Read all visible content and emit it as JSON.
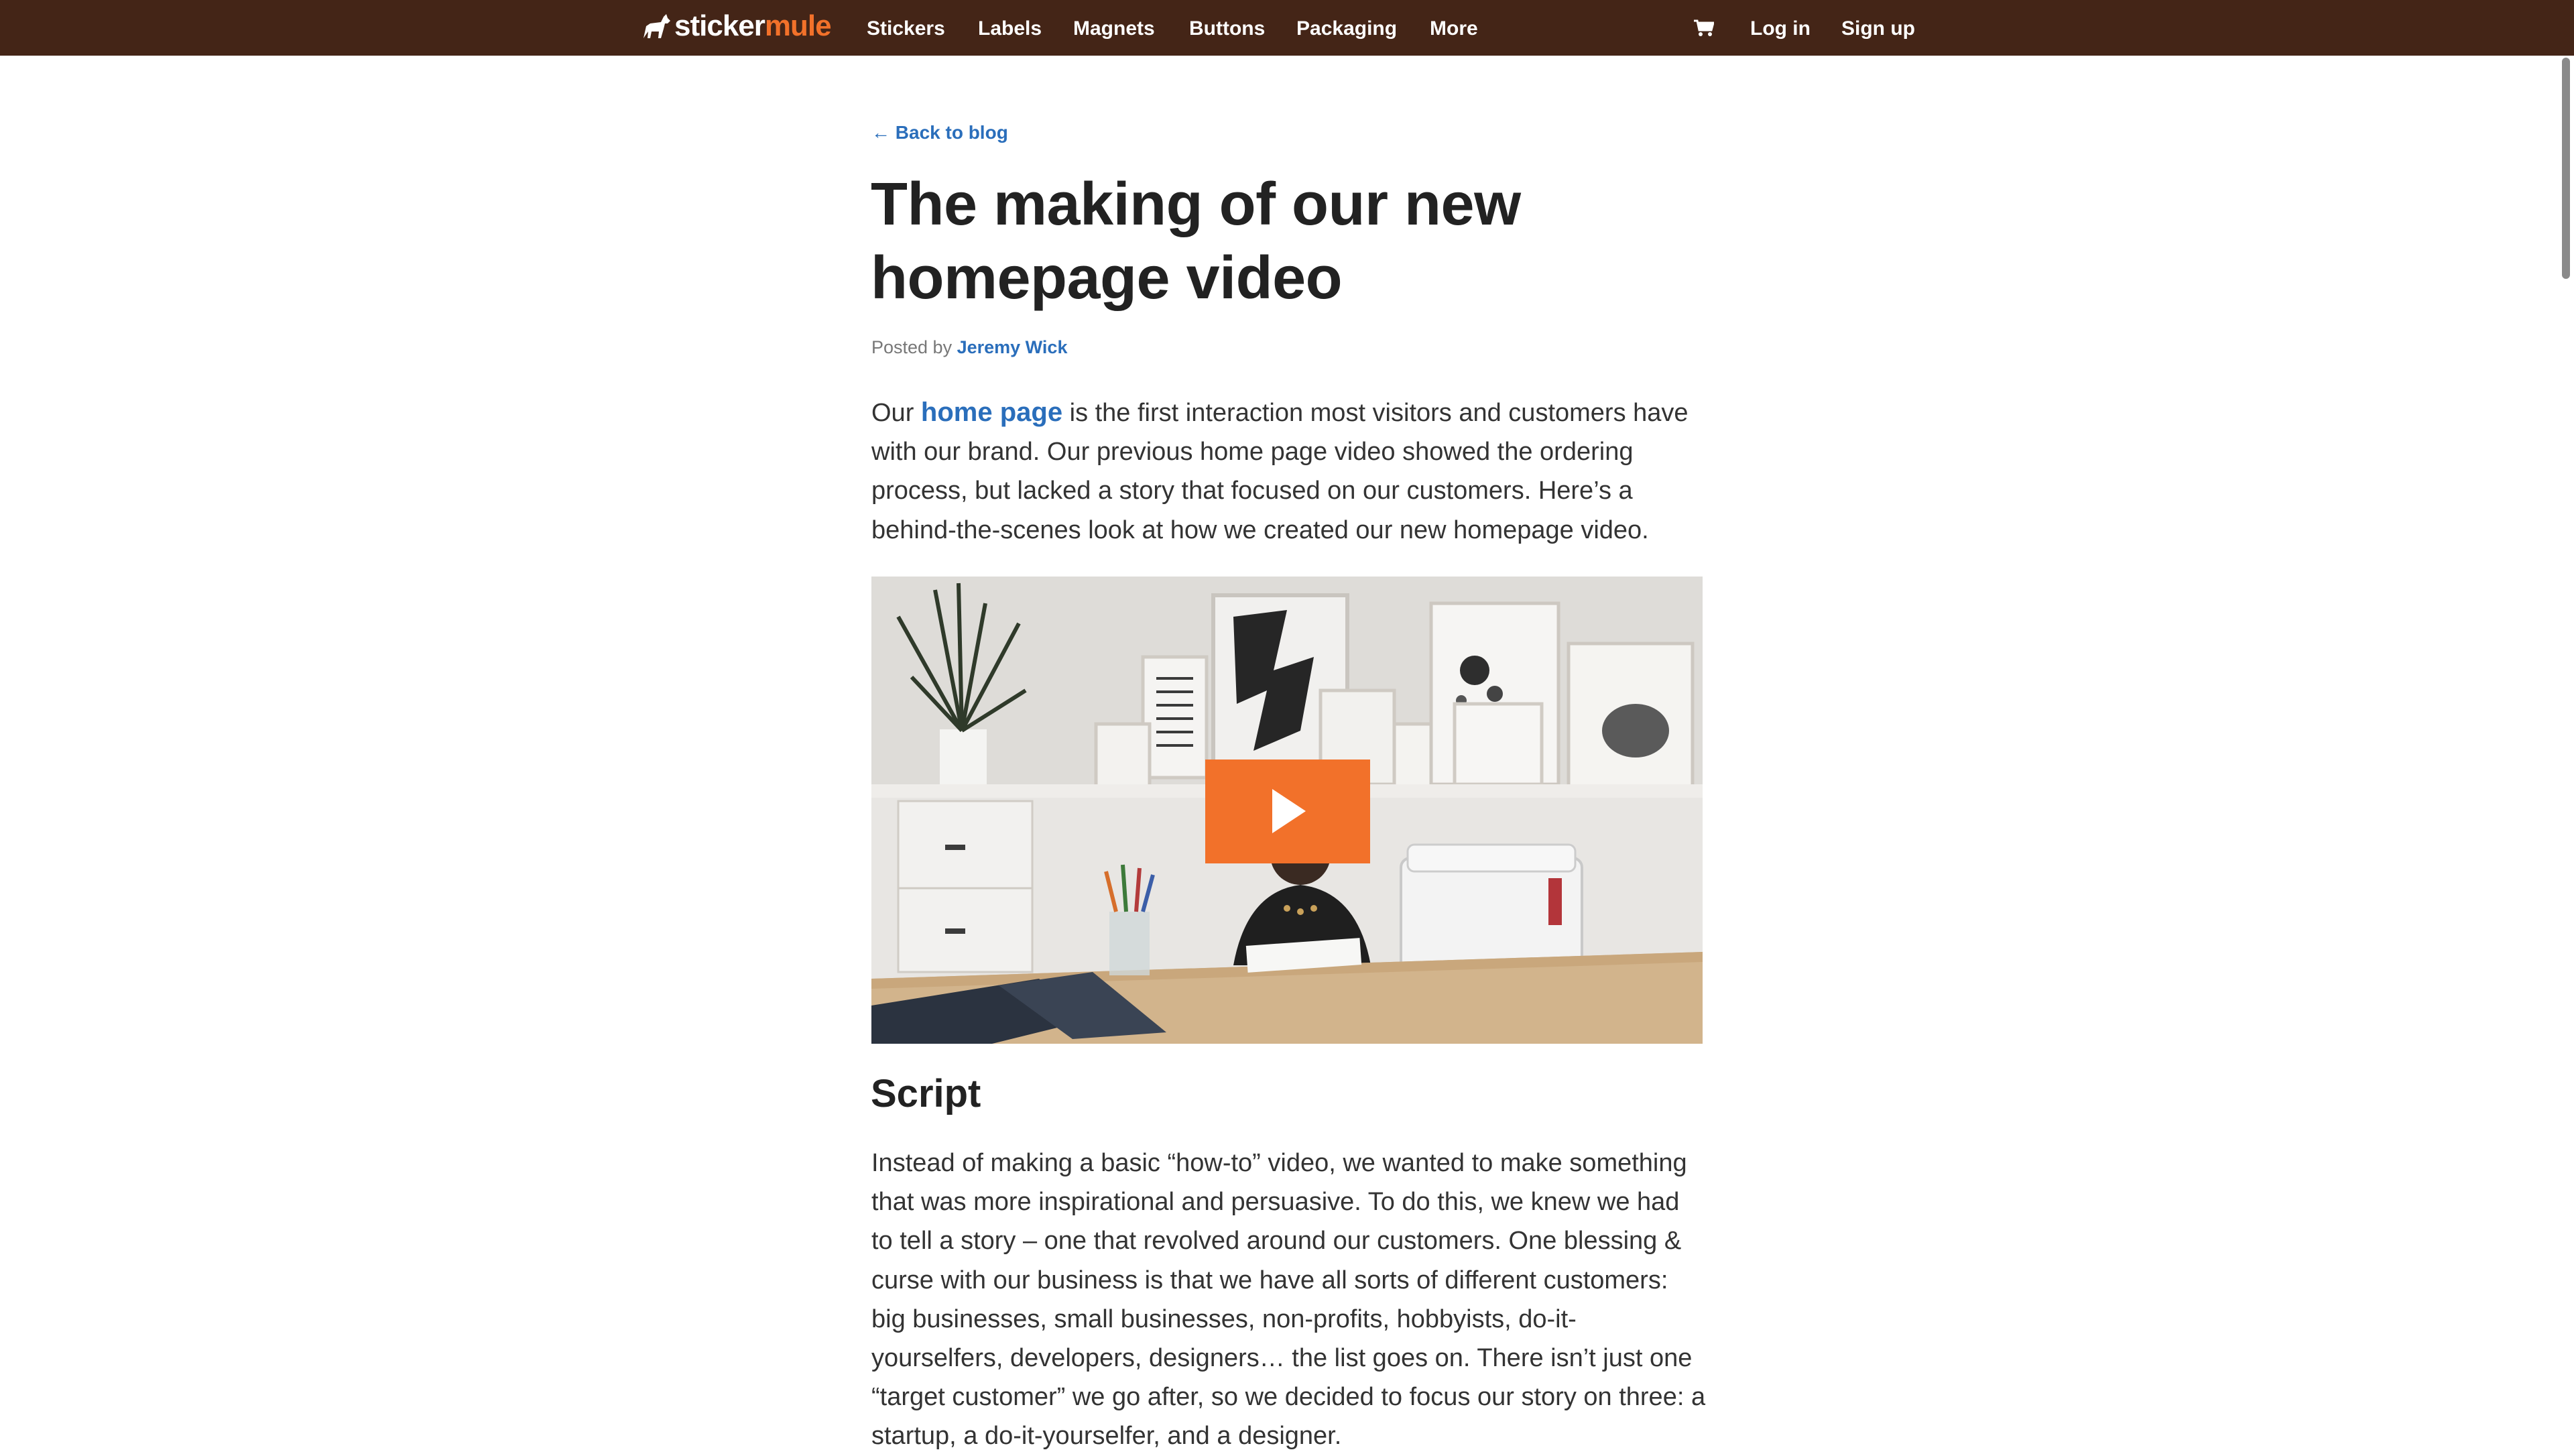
{
  "nav": {
    "logo_left": "sticker",
    "logo_right": "mule",
    "links": [
      "Stickers",
      "Labels",
      "Magnets",
      "Buttons",
      "Packaging",
      "More"
    ],
    "cart_icon": "cart-icon",
    "login": "Log in",
    "signup": "Sign up"
  },
  "article": {
    "back_link": "← Back to blog",
    "title": "The making of our new homepage video",
    "byline_prefix": "Posted by",
    "author": "Jeremy Wick",
    "intro": {
      "before_link": "Our ",
      "link": "home page",
      "after_link": " is the first interaction most visitors and customers have with our brand. Our previous home page video showed the ordering process, but lacked a story that focused on our customers. Here’s a behind-the-scenes look at how we created our new homepage video."
    },
    "video": {
      "play_icon": "play-icon"
    },
    "section_heading": "Script",
    "script_paragraph": "Instead of making a basic “how-to” video, we wanted to make something that was more inspirational and persuasive. To do this, we knew we had to tell a story – one that revolved around our customers. One blessing & curse with our business is that we have all sorts of different customers: big businesses, small businesses, non-profits, hobbyists, do-it-yourselfers, developers, designers… the list goes on. There isn’t just one “target customer” we go after, so we decided to focus our story on three: a startup, a do-it-yourselfer, and a designer."
  },
  "colors": {
    "nav_bg": "#442517",
    "accent_orange": "#f2712a",
    "link_blue": "#2a6ebb"
  }
}
